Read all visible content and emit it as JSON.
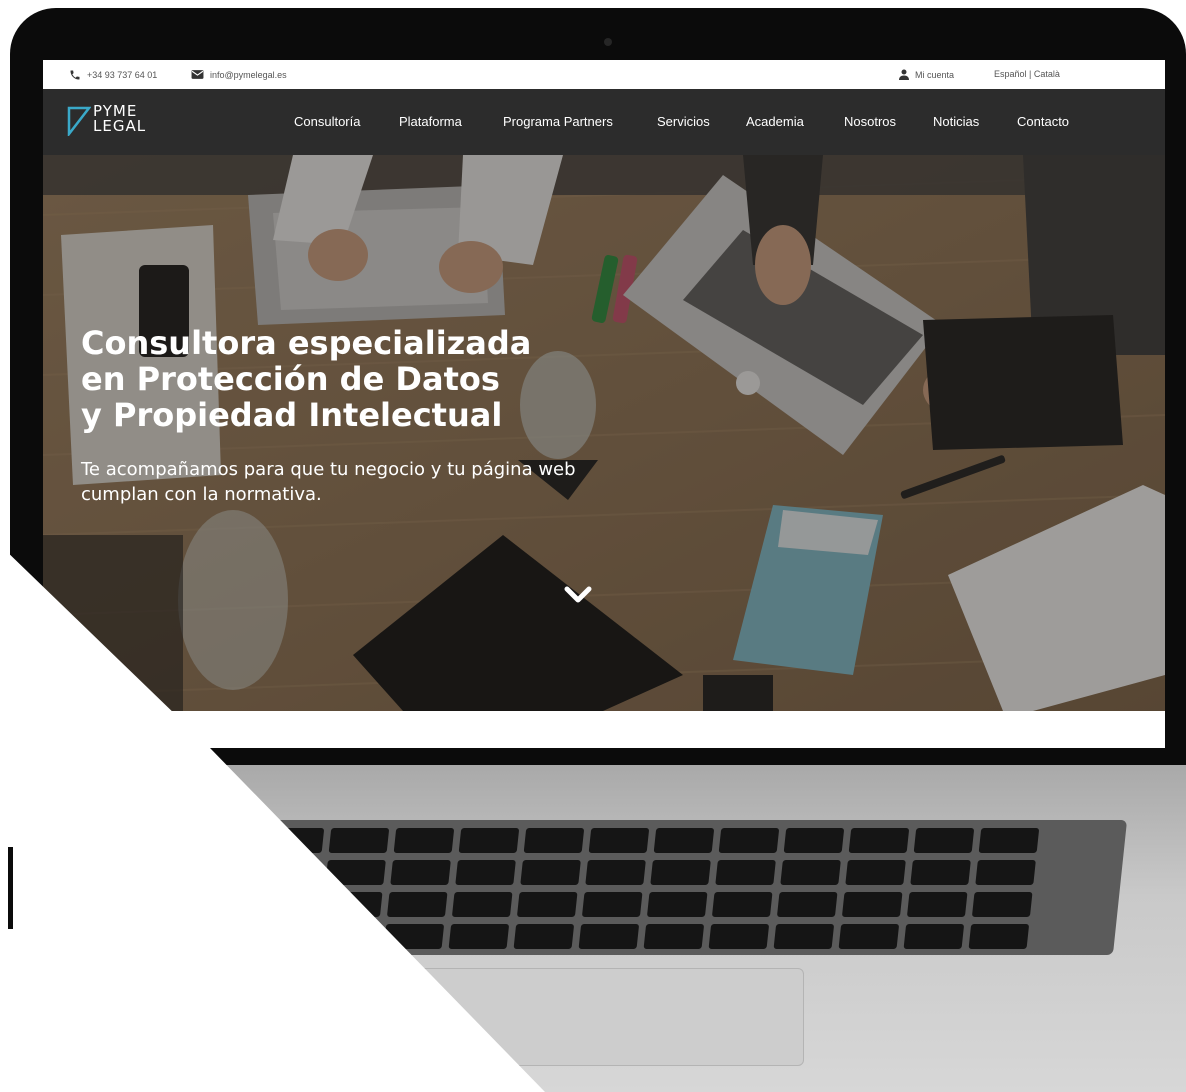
{
  "topbar": {
    "phone": "+34 93 737 64 01",
    "email": "info@pymelegal.es",
    "account": "Mi cuenta",
    "languages": "Español | Català"
  },
  "logo": {
    "line1": "PYME",
    "line2": "LEGAL"
  },
  "nav": {
    "items": [
      "Consultoría",
      "Plataforma",
      "Programa Partners",
      "Servicios",
      "Academia",
      "Nosotros",
      "Noticias",
      "Contacto"
    ]
  },
  "hero": {
    "title_lines": [
      "Consultora especializada",
      "en Protección de Datos",
      "y Propiedad Intelectual"
    ],
    "subtitle_lines": [
      "Te acompañamos para que tu negocio y tu página web",
      "cumplan con la normativa."
    ]
  },
  "icons": {
    "phone": "phone-icon",
    "email": "envelope-icon",
    "account": "user-icon",
    "scroll": "chevron-down-icon"
  },
  "colors": {
    "navbar": "#2c2c2c",
    "logo_accent": "#3aa9c9",
    "text_on_dark": "#ffffff"
  }
}
